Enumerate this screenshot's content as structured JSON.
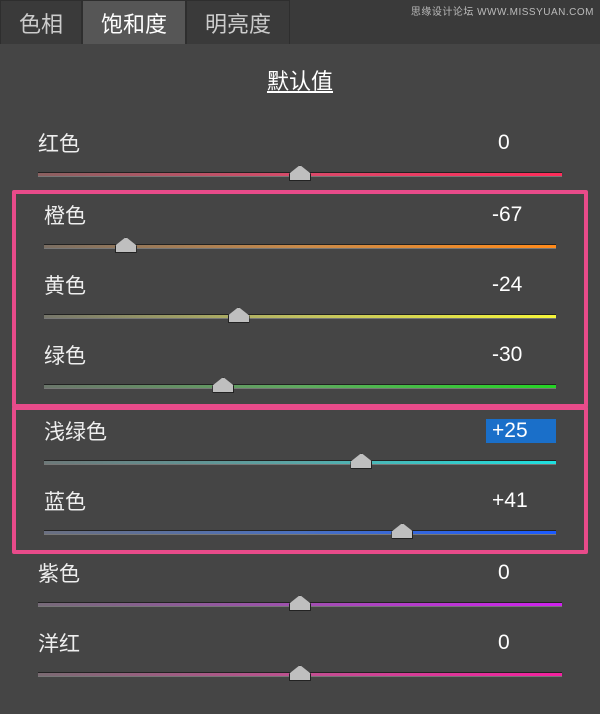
{
  "watermark": "思缘设计论坛  WWW.MISSYUAN.COM",
  "tabs": [
    {
      "label": "色相",
      "active": false
    },
    {
      "label": "饱和度",
      "active": true
    },
    {
      "label": "明亮度",
      "active": false
    }
  ],
  "subtitle": "默认值",
  "sliders": [
    {
      "name": "红色",
      "value": "0",
      "pos": 50,
      "grad": "g-red",
      "group": 0
    },
    {
      "name": "橙色",
      "value": "-67",
      "pos": 16,
      "grad": "g-orange",
      "group": 1
    },
    {
      "name": "黄色",
      "value": "-24",
      "pos": 38,
      "grad": "g-yellow",
      "group": 1
    },
    {
      "name": "绿色",
      "value": "-30",
      "pos": 35,
      "grad": "g-green",
      "group": 1
    },
    {
      "name": "浅绿色",
      "value": "+25",
      "pos": 62,
      "grad": "g-aqua",
      "group": 2,
      "selected": true
    },
    {
      "name": "蓝色",
      "value": "+41",
      "pos": 70,
      "grad": "g-blue",
      "group": 2
    },
    {
      "name": "紫色",
      "value": "0",
      "pos": 50,
      "grad": "g-purple",
      "group": 0
    },
    {
      "name": "洋红",
      "value": "0",
      "pos": 50,
      "grad": "g-magenta",
      "group": 0
    }
  ]
}
